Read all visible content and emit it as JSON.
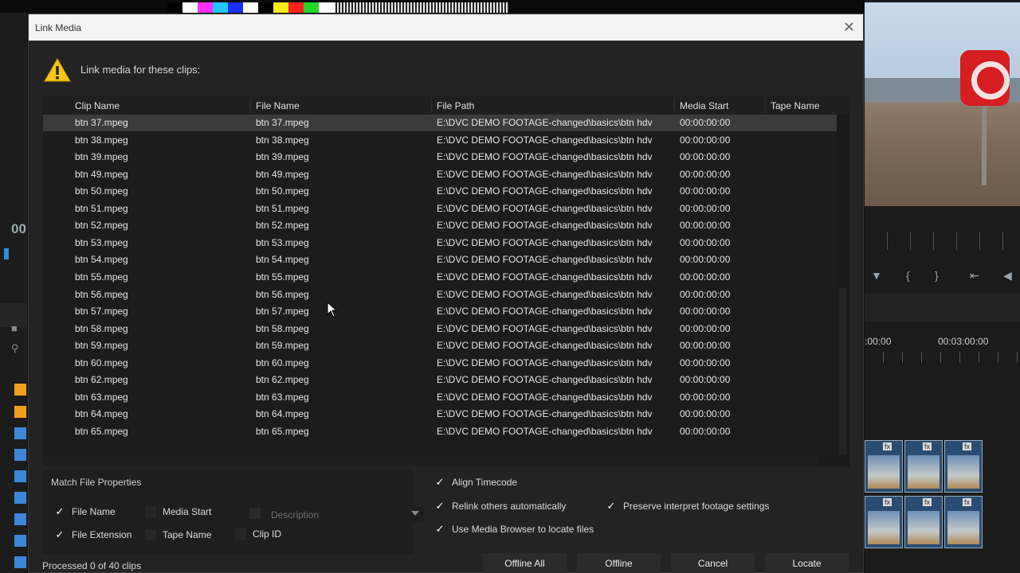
{
  "dialog": {
    "title": "Link Media",
    "heading": "Link media for these clips:",
    "status": "Processed 0 of 40 clips"
  },
  "table": {
    "columns": [
      "Clip Name",
      "File Name",
      "File Path",
      "Media Start",
      "Tape Name"
    ],
    "rows": [
      [
        "btn 37.mpeg",
        "btn 37.mpeg",
        "E:\\DVC DEMO FOOTAGE-changed\\basics\\btn hdv",
        "00:00:00:00",
        ""
      ],
      [
        "btn 38.mpeg",
        "btn 38.mpeg",
        "E:\\DVC DEMO FOOTAGE-changed\\basics\\btn hdv",
        "00:00:00:00",
        ""
      ],
      [
        "btn 39.mpeg",
        "btn 39.mpeg",
        "E:\\DVC DEMO FOOTAGE-changed\\basics\\btn hdv",
        "00:00:00:00",
        ""
      ],
      [
        "btn 49.mpeg",
        "btn 49.mpeg",
        "E:\\DVC DEMO FOOTAGE-changed\\basics\\btn hdv",
        "00:00:00:00",
        ""
      ],
      [
        "btn 50.mpeg",
        "btn 50.mpeg",
        "E:\\DVC DEMO FOOTAGE-changed\\basics\\btn hdv",
        "00:00:00:00",
        ""
      ],
      [
        "btn 51.mpeg",
        "btn 51.mpeg",
        "E:\\DVC DEMO FOOTAGE-changed\\basics\\btn hdv",
        "00:00:00:00",
        ""
      ],
      [
        "btn 52.mpeg",
        "btn 52.mpeg",
        "E:\\DVC DEMO FOOTAGE-changed\\basics\\btn hdv",
        "00:00:00:00",
        ""
      ],
      [
        "btn 53.mpeg",
        "btn 53.mpeg",
        "E:\\DVC DEMO FOOTAGE-changed\\basics\\btn hdv",
        "00:00:00:00",
        ""
      ],
      [
        "btn 54.mpeg",
        "btn 54.mpeg",
        "E:\\DVC DEMO FOOTAGE-changed\\basics\\btn hdv",
        "00:00:00:00",
        ""
      ],
      [
        "btn 55.mpeg",
        "btn 55.mpeg",
        "E:\\DVC DEMO FOOTAGE-changed\\basics\\btn hdv",
        "00:00:00:00",
        ""
      ],
      [
        "btn 56.mpeg",
        "btn 56.mpeg",
        "E:\\DVC DEMO FOOTAGE-changed\\basics\\btn hdv",
        "00:00:00:00",
        ""
      ],
      [
        "btn 57.mpeg",
        "btn 57.mpeg",
        "E:\\DVC DEMO FOOTAGE-changed\\basics\\btn hdv",
        "00:00:00:00",
        ""
      ],
      [
        "btn 58.mpeg",
        "btn 58.mpeg",
        "E:\\DVC DEMO FOOTAGE-changed\\basics\\btn hdv",
        "00:00:00:00",
        ""
      ],
      [
        "btn 59.mpeg",
        "btn 59.mpeg",
        "E:\\DVC DEMO FOOTAGE-changed\\basics\\btn hdv",
        "00:00:00:00",
        ""
      ],
      [
        "btn 60.mpeg",
        "btn 60.mpeg",
        "E:\\DVC DEMO FOOTAGE-changed\\basics\\btn hdv",
        "00:00:00:00",
        ""
      ],
      [
        "btn 62.mpeg",
        "btn 62.mpeg",
        "E:\\DVC DEMO FOOTAGE-changed\\basics\\btn hdv",
        "00:00:00:00",
        ""
      ],
      [
        "btn 63.mpeg",
        "btn 63.mpeg",
        "E:\\DVC DEMO FOOTAGE-changed\\basics\\btn hdv",
        "00:00:00:00",
        ""
      ],
      [
        "btn 64.mpeg",
        "btn 64.mpeg",
        "E:\\DVC DEMO FOOTAGE-changed\\basics\\btn hdv",
        "00:00:00:00",
        ""
      ],
      [
        "btn 65.mpeg",
        "btn 65.mpeg",
        "E:\\DVC DEMO FOOTAGE-changed\\basics\\btn hdv",
        "00:00:00:00",
        ""
      ]
    ],
    "selected_row": 0
  },
  "match": {
    "label": "Match File Properties",
    "file_name": "File Name",
    "file_extension": "File Extension",
    "media_start": "Media Start",
    "tape_name": "Tape Name",
    "description": "Description",
    "clip_id": "Clip ID"
  },
  "options": {
    "align_timecode": "Align Timecode",
    "relink_others": "Relink others automatically",
    "preserve_interpret": "Preserve interpret footage settings",
    "use_media_browser": "Use Media Browser to locate files"
  },
  "buttons": {
    "offline_all": "Offline All",
    "offline": "Offline",
    "cancel": "Cancel",
    "locate": "Locate"
  },
  "background": {
    "left_timecode": "00",
    "timeline_tc_a": ":00:00",
    "timeline_tc_b": "00:03:00:00",
    "fx_label": "fx"
  },
  "colors": {
    "accent_orange": "#f0a020",
    "accent_blue": "#3d86d8",
    "warning_yellow": "#f5c518"
  }
}
